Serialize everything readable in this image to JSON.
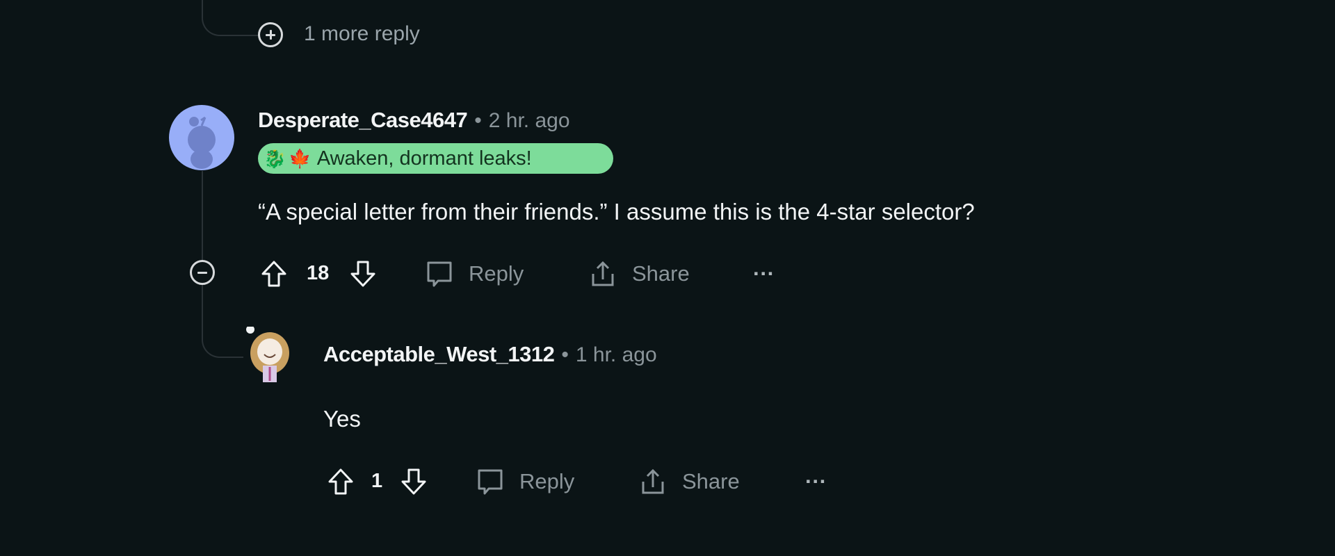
{
  "thread": {
    "more_replies": {
      "label": "1 more reply",
      "icon": "plus-circle-icon"
    }
  },
  "comments": [
    {
      "username": "Desperate_Case4647",
      "separator": "•",
      "time": "2 hr. ago",
      "avatar": "default-snoo-avatar",
      "flair": {
        "emojis": [
          "dragon-emoji",
          "maple-leaf-emoji"
        ],
        "text": "Awaken, dormant leaks!",
        "color": "#7ddc9a"
      },
      "body": "“A special letter from their friends.” I assume this is the 4-star selector?",
      "collapse_icon": "minus-circle-icon",
      "votes": "18",
      "actions": {
        "reply": "Reply",
        "share": "Share",
        "more": "···"
      }
    },
    {
      "username": "Acceptable_West_1312",
      "separator": "•",
      "time": "1 hr. ago",
      "avatar": "custom-anime-avatar",
      "body": "Yes",
      "votes": "1",
      "actions": {
        "reply": "Reply",
        "share": "Share",
        "more": "···"
      }
    }
  ],
  "colors": {
    "background": "#0b1416",
    "thread_line": "#2a3236",
    "muted_text": "#8b959a",
    "flair_bg": "#7ddc9a",
    "avatar_bg": "#98aef8"
  }
}
